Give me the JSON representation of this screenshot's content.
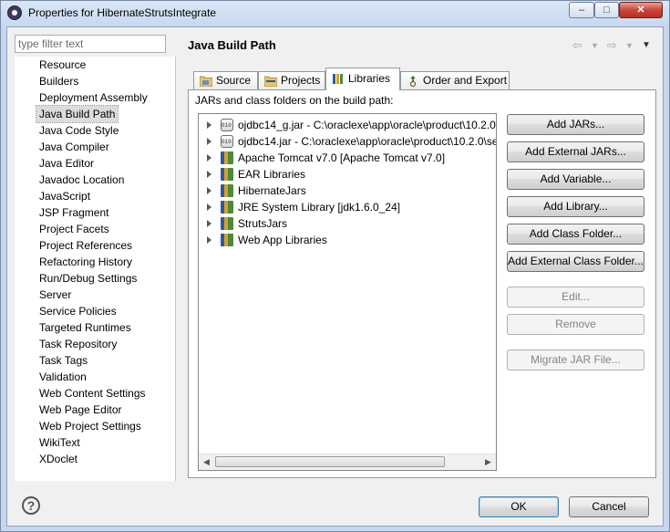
{
  "window": {
    "title": "Properties for HibernateStrutsIntegrate"
  },
  "filter": {
    "placeholder": "type filter text"
  },
  "nav": {
    "items": [
      "Resource",
      "Builders",
      "Deployment Assembly",
      "Java Build Path",
      "Java Code Style",
      "Java Compiler",
      "Java Editor",
      "Javadoc Location",
      "JavaScript",
      "JSP Fragment",
      "Project Facets",
      "Project References",
      "Refactoring History",
      "Run/Debug Settings",
      "Server",
      "Service Policies",
      "Targeted Runtimes",
      "Task Repository",
      "Task Tags",
      "Validation",
      "Web Content Settings",
      "Web Page Editor",
      "Web Project Settings",
      "WikiText",
      "XDoclet"
    ],
    "selected": "Java Build Path"
  },
  "page": {
    "title": "Java Build Path"
  },
  "tabs": [
    {
      "label": "Source",
      "icon": "source-folder-icon"
    },
    {
      "label": "Projects",
      "icon": "projects-icon"
    },
    {
      "label": "Libraries",
      "icon": "libraries-icon"
    },
    {
      "label": "Order and Export",
      "icon": "order-export-icon"
    }
  ],
  "active_tab": "Libraries",
  "libraries": {
    "label": "JARs and class folders on the build path:",
    "entries": [
      {
        "label": "ojdbc14_g.jar - C:\\oraclexe\\app\\oracle\\product\\10.2.0\\s",
        "icon": "jar-icon"
      },
      {
        "label": "ojdbc14.jar - C:\\oraclexe\\app\\oracle\\product\\10.2.0\\ser",
        "icon": "jar-icon"
      },
      {
        "label": "Apache Tomcat v7.0 [Apache Tomcat v7.0]",
        "icon": "library-icon"
      },
      {
        "label": "EAR Libraries",
        "icon": "library-icon"
      },
      {
        "label": "HibernateJars",
        "icon": "library-icon"
      },
      {
        "label": "JRE System Library [jdk1.6.0_24]",
        "icon": "library-icon"
      },
      {
        "label": "StrutsJars",
        "icon": "library-icon"
      },
      {
        "label": "Web App Libraries",
        "icon": "library-icon"
      }
    ]
  },
  "buttons": {
    "add_jars": "Add JARs...",
    "add_external_jars": "Add External JARs...",
    "add_variable": "Add Variable...",
    "add_library": "Add Library...",
    "add_class_folder": "Add Class Folder...",
    "add_external_class_folder": "Add External Class Folder...",
    "edit": "Edit...",
    "remove": "Remove",
    "migrate_jar": "Migrate JAR File..."
  },
  "dialog": {
    "ok": "OK",
    "cancel": "Cancel"
  }
}
